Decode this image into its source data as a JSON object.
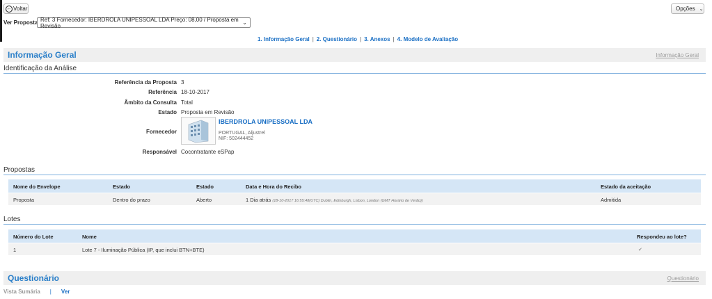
{
  "toolbar": {
    "back_label": "Voltar",
    "options_label": "Opções"
  },
  "proposal_selector": {
    "label": "Ver Proposta:",
    "selected": "Ref: 3 Fornecedor: IBERDROLA UNIPESSOAL LDA Preço: 08,00 / Proposta em Revisão"
  },
  "tabs": [
    {
      "label": "1. Informação Geral"
    },
    {
      "label": "2. Questionário"
    },
    {
      "label": "3. Anexos"
    },
    {
      "label": "4. Modelo de Avaliação"
    }
  ],
  "tab_separator": "|",
  "info_section": {
    "title": "Informação Geral",
    "link": "Informação Geral"
  },
  "identification": {
    "heading": "Identificação da Análise",
    "fields": [
      {
        "label": "Referência da Proposta",
        "value": "3"
      },
      {
        "label": "Referência",
        "value": "18-10-2017"
      },
      {
        "label": "Âmbito da Consulta",
        "value": "Total"
      },
      {
        "label": "Estado",
        "value": "Proposta em Revisão"
      },
      {
        "label": "Fornecedor",
        "value": ""
      },
      {
        "label": "Responsável",
        "value": "Cocontratante eSPap"
      }
    ],
    "supplier": {
      "name": "IBERDROLA UNIPESSOAL LDA",
      "location": "PORTUGAL, Aljustrel",
      "nif": "NIF: 502444452"
    }
  },
  "proposals": {
    "heading": "Propostas",
    "columns": [
      "Nome do Envelope",
      "Estado",
      "Estado",
      "Data e Hora do Recibo",
      "Estado da aceitação"
    ],
    "rows": [
      {
        "envelope": "Proposta",
        "estado1": "Dentro do prazo",
        "estado2": "Aberto",
        "received": "1 Dia atrás",
        "received_detail": "(18-10-2017 16:55:48(UTC) Dublin, Edinburgh, Lisbon, London (GMT Horário de Verão))",
        "acceptance": "Admitida"
      }
    ]
  },
  "lots": {
    "heading": "Lotes",
    "columns": [
      "Número do Lote",
      "Nome",
      "Respondeu ao lote?"
    ],
    "rows": [
      {
        "number": "1",
        "name": "Lote 7 - Iluminação Pública (IP, que inclui BTN+BTE)",
        "responded_icon": "check-icon"
      }
    ]
  },
  "questionnaire_section": {
    "title": "Questionário",
    "link": "Questionário"
  },
  "bottom_links": {
    "summary": "Vista Sumária",
    "separator": "|",
    "view": "Ver"
  },
  "colors": {
    "accent": "#2a7fc9",
    "link": "#1a6fc4",
    "table_header": "#d5e6f6",
    "section_bar": "#efefef"
  }
}
